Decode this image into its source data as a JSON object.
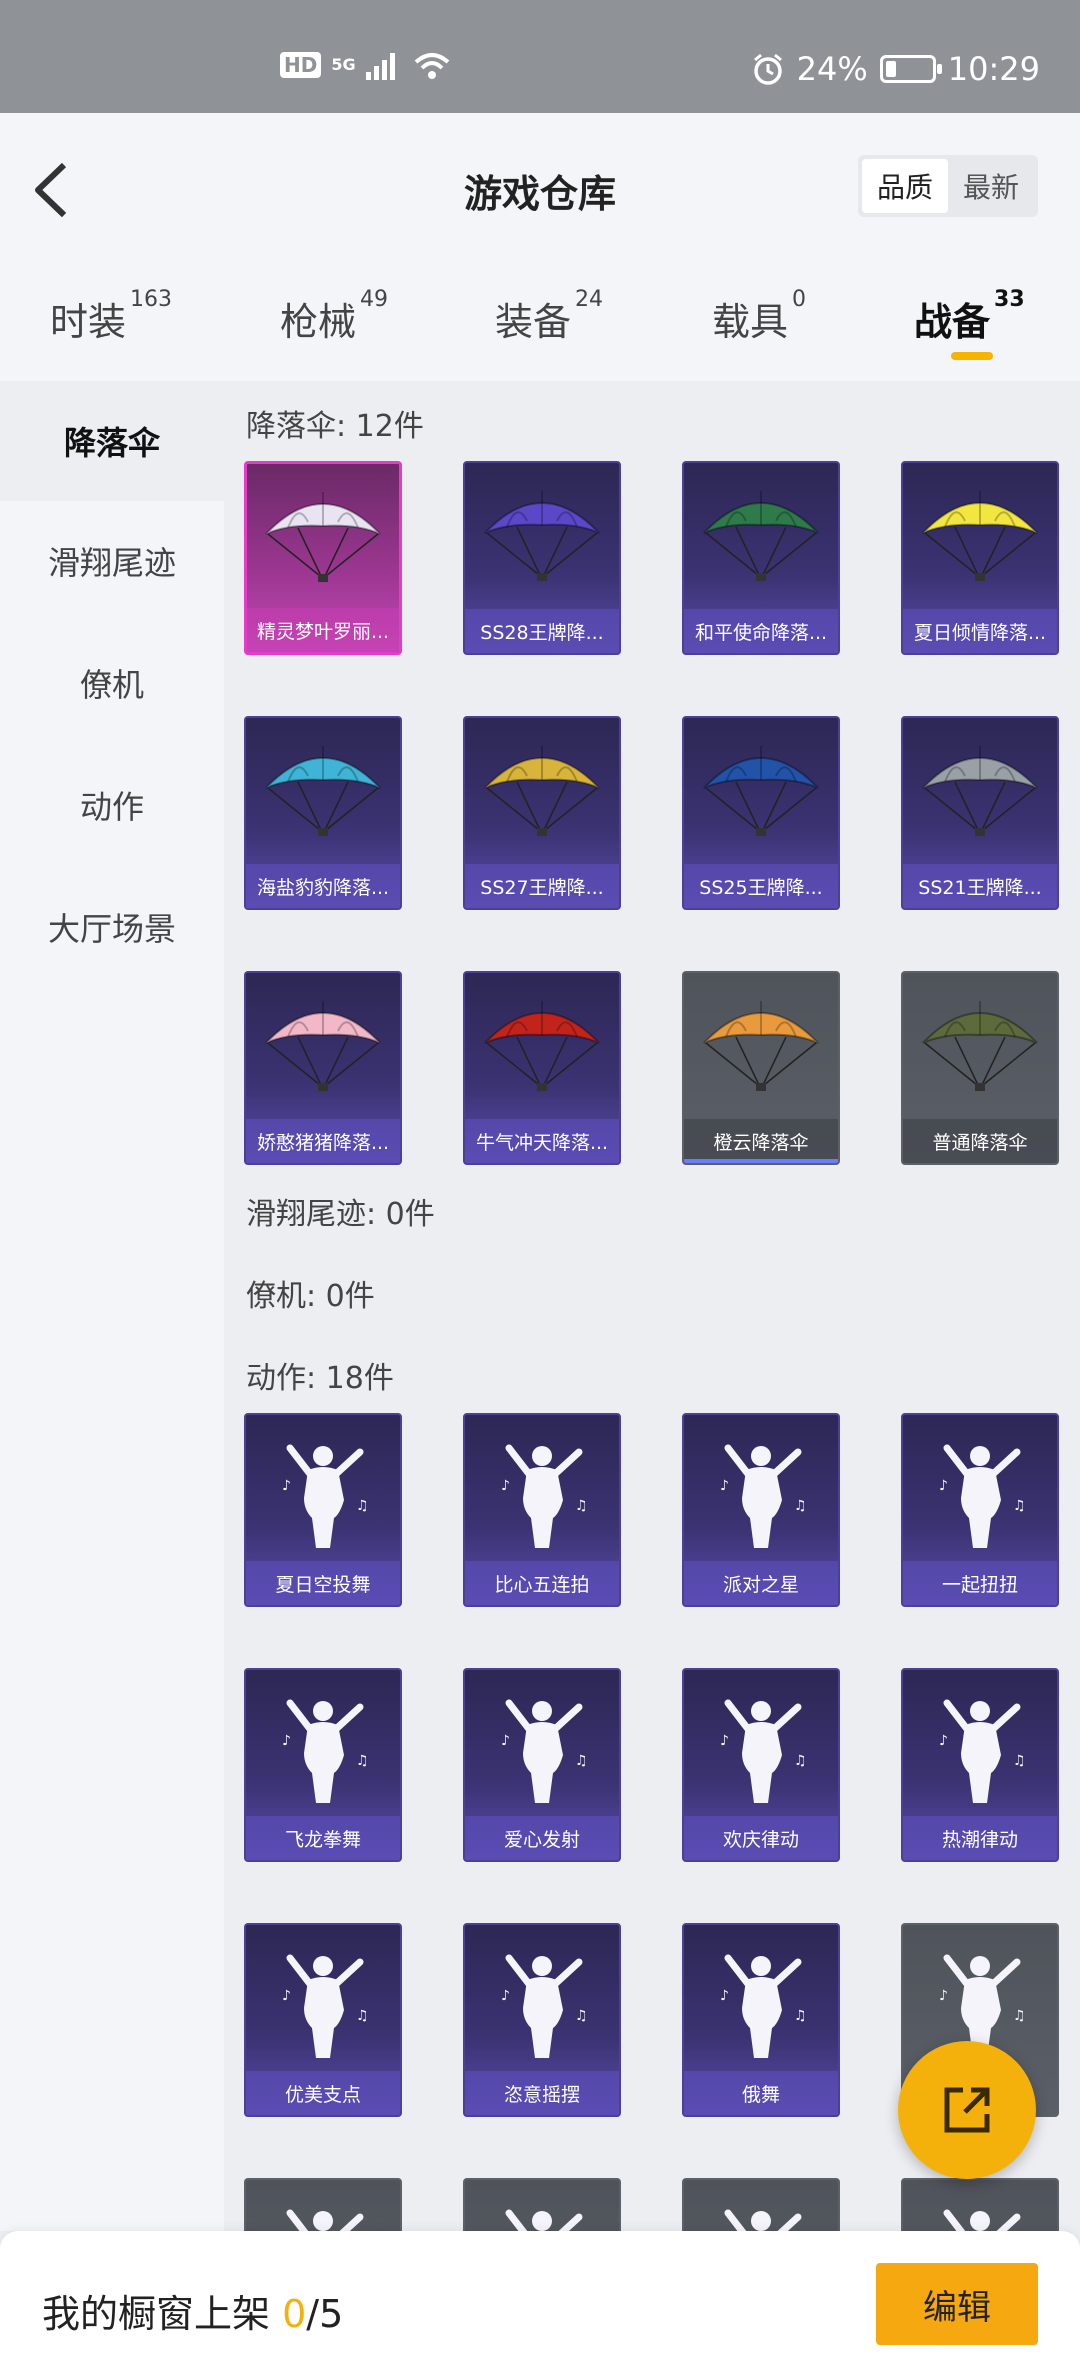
{
  "status_bar": {
    "hd": "HD",
    "net": "5G",
    "battery": "24%",
    "time": "10:29",
    "battery_level": 0.24
  },
  "header": {
    "title": "游戏仓库",
    "sort_options": [
      "品质",
      "最新"
    ]
  },
  "tabs": [
    {
      "label": "时装",
      "count": "163"
    },
    {
      "label": "枪械",
      "count": "49"
    },
    {
      "label": "装备",
      "count": "24"
    },
    {
      "label": "载具",
      "count": "0"
    },
    {
      "label": "战备",
      "count": "33"
    }
  ],
  "sidebar": {
    "items": [
      "降落伞",
      "滑翔尾迹",
      "僚机",
      "动作",
      "大厅场景"
    ]
  },
  "sections": {
    "parachute": "降落伞: 12件",
    "trail": "滑翔尾迹: 0件",
    "wingman": "僚机: 0件",
    "emote": "动作: 18件"
  },
  "parachutes": [
    {
      "label": "精灵梦叶罗丽...",
      "style": "pink",
      "color": "#e8e4f2"
    },
    {
      "label": "SS28王牌降...",
      "style": "purple",
      "color": "#5a48c8"
    },
    {
      "label": "和平使命降落...",
      "style": "purple",
      "color": "#2f7a4b"
    },
    {
      "label": "夏日倾情降落...",
      "style": "purple",
      "color": "#f2e640"
    },
    {
      "label": "海盐豹豹降落...",
      "style": "purple",
      "color": "#3fb4d6"
    },
    {
      "label": "SS27王牌降...",
      "style": "purple",
      "color": "#d9b43a"
    },
    {
      "label": "SS25王牌降...",
      "style": "purple",
      "color": "#2253a8"
    },
    {
      "label": "SS21王牌降...",
      "style": "purple",
      "color": "#9aa1a6"
    },
    {
      "label": "娇憨猪猪降落...",
      "style": "purple",
      "color": "#f3b8c8"
    },
    {
      "label": "牛气冲天降落...",
      "style": "purple",
      "color": "#c2241c"
    },
    {
      "label": "橙云降落伞",
      "style": "gray",
      "color": "#e89a3c"
    },
    {
      "label": "普通降落伞",
      "style": "gray",
      "color": "#5d6a3c"
    }
  ],
  "emotes": [
    {
      "label": "夏日空投舞",
      "style": "purple"
    },
    {
      "label": "比心五连拍",
      "style": "purple"
    },
    {
      "label": "派对之星",
      "style": "purple"
    },
    {
      "label": "一起扭扭",
      "style": "purple"
    },
    {
      "label": "飞龙拳舞",
      "style": "purple"
    },
    {
      "label": "爱心发射",
      "style": "purple"
    },
    {
      "label": "欢庆律动",
      "style": "purple"
    },
    {
      "label": "热潮律动",
      "style": "purple"
    },
    {
      "label": "优美支点",
      "style": "purple"
    },
    {
      "label": "恣意摇摆",
      "style": "purple"
    },
    {
      "label": "俄舞",
      "style": "purple"
    },
    {
      "label": "",
      "style": "gray"
    }
  ],
  "bottom_bar": {
    "prefix": "我的橱窗上架 ",
    "current": "0",
    "total": "/5",
    "edit_label": "编辑"
  },
  "colors": {
    "accent": "#f5b10b",
    "card_purple": "#3b3373",
    "card_gray": "#5b5f67",
    "card_pink": "#c24ab4"
  }
}
